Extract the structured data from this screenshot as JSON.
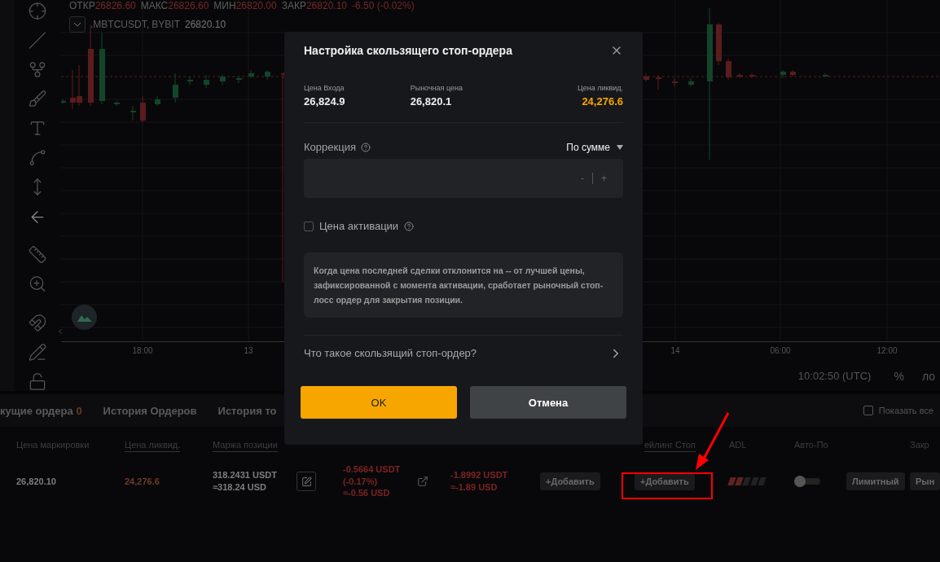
{
  "chart": {
    "legend": [
      {
        "label": "ОТКР",
        "value": "26826.60"
      },
      {
        "label": "МАКС",
        "value": "26826.60"
      },
      {
        "label": "МИН",
        "value": "26820.00"
      },
      {
        "label": "ЗАКР",
        "value": "26820.10"
      }
    ],
    "change": "-6.50 (-0.02%)",
    "symbol": ".MBTCUSDT, BYBIT",
    "last_price": "26820.10",
    "x_labels": [
      "18:00",
      "13",
      "14",
      "06:00",
      "12:00"
    ],
    "clock": "10:02:50 (UTC)",
    "percent_toggle": "%",
    "log_toggle": "ло"
  },
  "positions": {
    "tabs": [
      {
        "label": "кущие ордера",
        "count": "0"
      },
      {
        "label": "История Ордеров"
      },
      {
        "label": "История то"
      }
    ],
    "show_all": {
      "label": "Показать все",
      "checked": false
    },
    "columns": [
      {
        "label": "Цена маркировки",
        "underlined": false
      },
      {
        "label": "Цена ликвид.",
        "underlined": true
      },
      {
        "label": "Маржа позиции",
        "underlined": true
      },
      {
        "label": "ейлинг Стоп",
        "underlined": true
      },
      {
        "label": "ADL",
        "underlined": false
      },
      {
        "label": "Авто-По",
        "underlined": false
      },
      {
        "label": "Закр",
        "underlined": false
      }
    ],
    "row": [
      {
        "kind": "text",
        "color": "#7d7d7d",
        "lines": [
          "26,820.10"
        ]
      },
      {
        "kind": "text",
        "color": "#6e3b2a",
        "lines": [
          "24,276.6"
        ]
      },
      {
        "kind": "text",
        "color": "#7d7d7d",
        "lines": [
          "318.2431 USDT",
          "≈318.24 USD"
        ]
      },
      {
        "kind": "edit"
      },
      {
        "kind": "text",
        "color": "#7d2323",
        "lines": [
          "-0.5664 USDT",
          "(-0.17%)",
          "≈-0.56 USD"
        ]
      },
      {
        "kind": "share"
      },
      {
        "kind": "text",
        "color": "#7d2323",
        "lines": [
          "-1.8992 USDT",
          "≈-1.89 USD"
        ]
      },
      {
        "kind": "button",
        "label": "+Добавить"
      },
      {
        "kind": "button",
        "label": "+Добавить"
      },
      {
        "kind": "adl",
        "level": 0.4
      },
      {
        "kind": "toggle",
        "on": false
      },
      {
        "kind": "button",
        "label": "Лимитный"
      },
      {
        "kind": "button",
        "label": "Рын"
      }
    ]
  },
  "dialog": {
    "title": "Настройка скользящего стоп-ордера",
    "stats": [
      {
        "label": "Цена Входа",
        "value": "26,824.9"
      },
      {
        "label": "Рыночная цена",
        "value": "26,820.1"
      },
      {
        "label": "Цена ликвид.",
        "value": "24,276.6",
        "color": "#f7a600"
      }
    ],
    "correction": {
      "label": "Коррекция",
      "mode": "По сумме",
      "minus": "-",
      "plus": "+"
    },
    "activation": {
      "label": "Цена активации",
      "checked": false
    },
    "info": "Когда цена последней сделки отклонится на -- от лучшей цены, зафиксированной с момента активации, сработает рыночный стоп-лосс ордер для закрытия позиции.",
    "link": "Что такое скользящий стоп-ордер?",
    "buttons": [
      {
        "label": "OK",
        "kind": "primary"
      },
      {
        "label": "Отмена",
        "kind": "secondary"
      }
    ]
  }
}
